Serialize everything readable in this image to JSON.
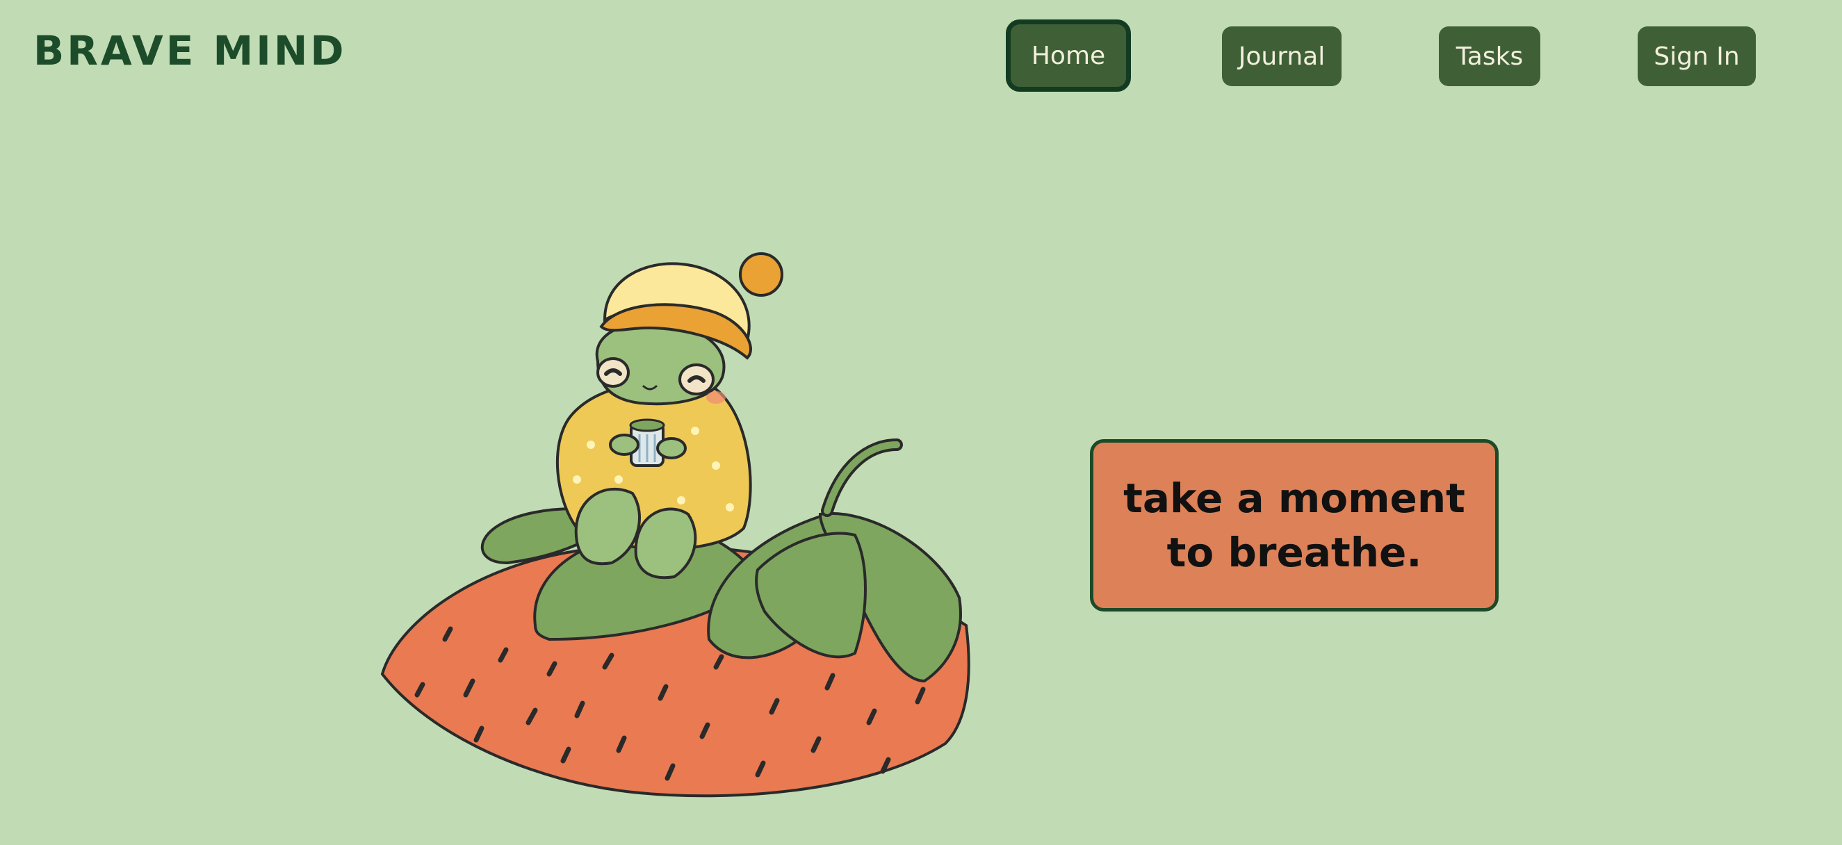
{
  "brand": {
    "title": "BRAVE MIND"
  },
  "nav": {
    "items": [
      {
        "label": "Home",
        "active": true
      },
      {
        "label": "Journal",
        "active": false
      },
      {
        "label": "Tasks",
        "active": false
      },
      {
        "label": "Sign In",
        "active": false
      }
    ]
  },
  "hero": {
    "illustration_icon": "frog-on-strawberry-illustration",
    "quote": "take a moment to breathe."
  },
  "colors": {
    "background": "#c1dcb4",
    "brand_text": "#1d4c2a",
    "nav_button": "#3f6036",
    "nav_text": "#f3efdd",
    "quote_box": "#dc8158"
  }
}
